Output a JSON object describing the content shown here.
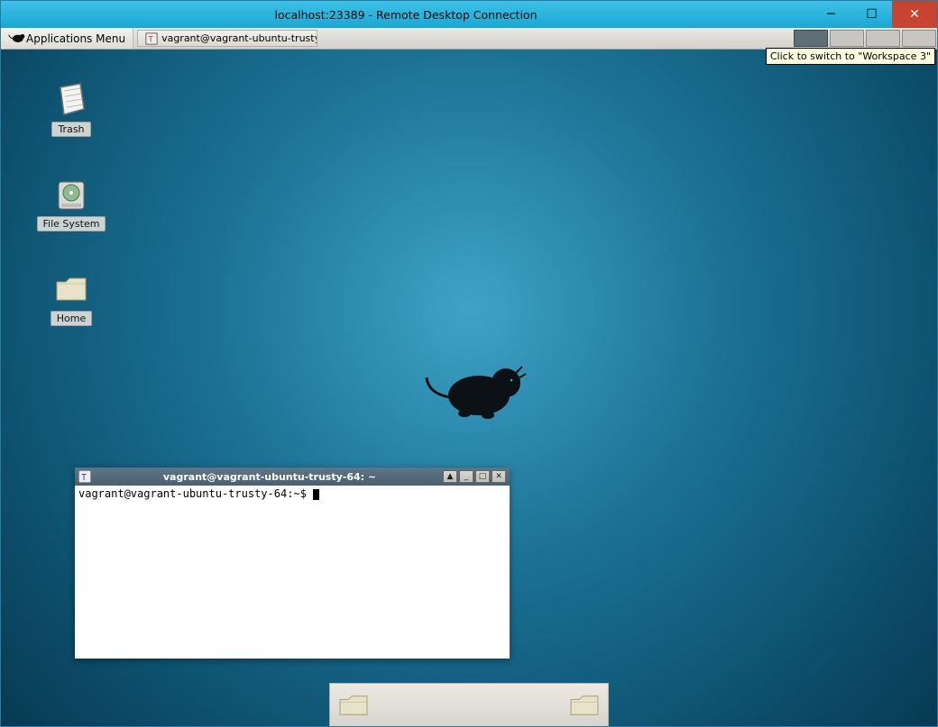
{
  "rdp": {
    "title": "localhost:23389 - Remote Desktop Connection",
    "controls": {
      "minimize": "–",
      "maximize": "▢",
      "close": "✕"
    }
  },
  "panel_top": {
    "app_menu_label": "Applications Menu",
    "taskbar_item_label": "vagrant@vagrant-ubuntu-trusty-...",
    "workspaces": [
      {
        "id": 1,
        "active": true
      },
      {
        "id": 2,
        "active": false
      },
      {
        "id": 3,
        "active": false
      },
      {
        "id": 4,
        "active": false
      }
    ],
    "tooltip_text": "Click to switch to \"Workspace 3\""
  },
  "desktop_icons": {
    "trash_label": "Trash",
    "filesystem_label": "File System",
    "home_label": "Home"
  },
  "terminal": {
    "window_title": "vagrant@vagrant-ubuntu-trusty-64: ~",
    "prompt": "vagrant@vagrant-ubuntu-trusty-64:~$ ",
    "controls": {
      "stick": "▲",
      "minimize": "_",
      "maximize": "□",
      "close": "✕"
    }
  },
  "panel_bottom": {
    "launcher_left_name": "file-manager",
    "launcher_right_name": "file-manager"
  }
}
